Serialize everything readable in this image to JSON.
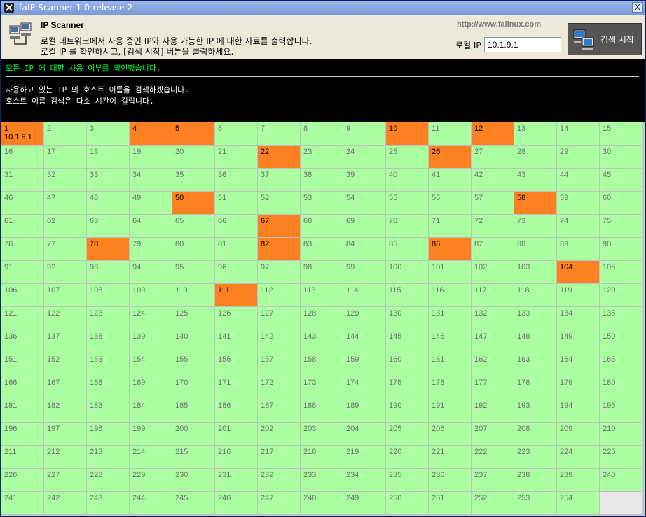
{
  "window": {
    "title": "faIP Scanner 1.0 release 2",
    "close_label": "X"
  },
  "header": {
    "app_name": "IP Scanner",
    "description_line1": "로컬 네트워크에서 사용 중인 IP와 사용 가능한 IP 에 대한 자료를 출력합니다.",
    "description_line2": "로컬 IP 를 확인하시고, [검색 시작] 버튼을 클릭하세요.",
    "url": "http://www.falinux.com",
    "local_ip_label": "로컬 IP",
    "local_ip_value": "10.1.9.1",
    "start_button_label": "검색 시작"
  },
  "console": {
    "status": "모든 IP 에 대한 사용 여부를 확인했습니다.",
    "message_line1": "사용하고 있는 IP 의 호스트 이름을 검색하겠습니다.",
    "message_line2": "호스트 이름 검색은 다소 시간이 걸립니다."
  },
  "grid": {
    "total": 254,
    "used": [
      1,
      4,
      5,
      10,
      12,
      22,
      26,
      50,
      58,
      67,
      78,
      82,
      86,
      104,
      111
    ],
    "hostnames": {
      "1": "10.1.9.1"
    },
    "colors": {
      "free": "#aaffa0",
      "used": "#ff8020",
      "empty": "#e8e8e8"
    }
  }
}
